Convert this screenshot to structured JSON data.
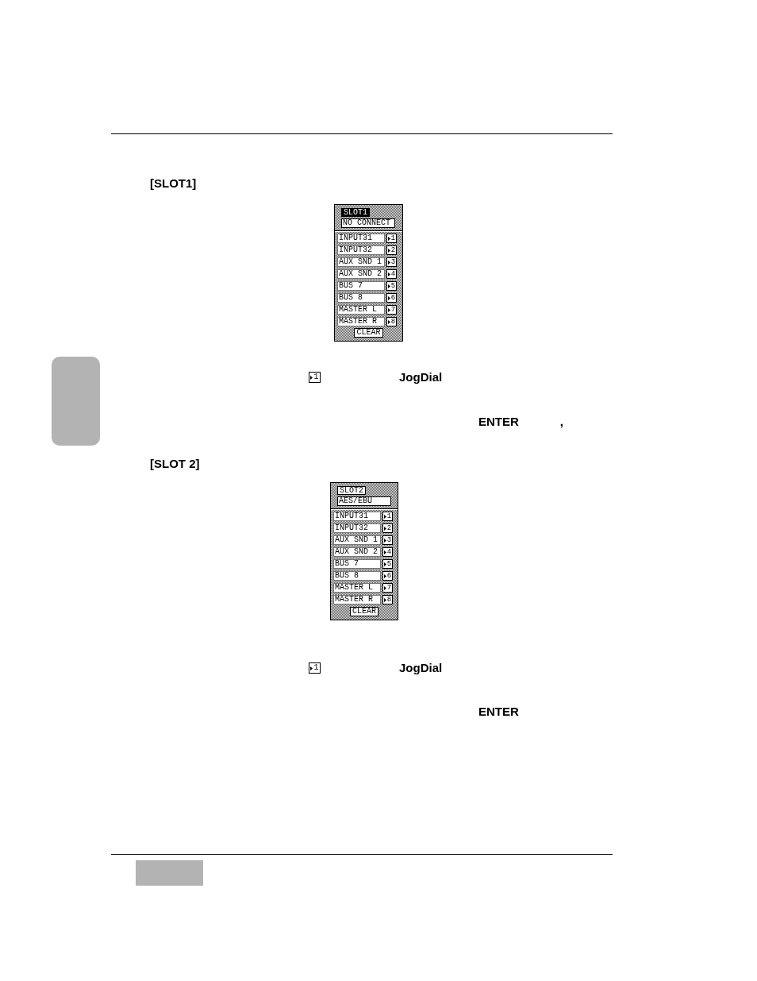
{
  "sections": [
    {
      "heading": "[SLOT1]",
      "panel": {
        "title": {
          "text": "SLOT1",
          "selected": true
        },
        "source": "NO CONNECT",
        "rows": [
          {
            "label": "INPUT31",
            "key": "1"
          },
          {
            "label": "INPUT32",
            "key": "2"
          },
          {
            "label": "AUX SND 1",
            "key": "3"
          },
          {
            "label": "AUX SND 2",
            "key": "4"
          },
          {
            "label": "BUS 7",
            "key": "5"
          },
          {
            "label": "BUS 8",
            "key": "6"
          },
          {
            "label": "MASTER L",
            "key": "7"
          },
          {
            "label": "MASTER R",
            "key": "8"
          }
        ],
        "clear_button": "CLEAR"
      },
      "steps": [
        {
          "kind": "dial",
          "key": "1",
          "control": "JogDial"
        },
        {
          "kind": "confirm",
          "control": "ENTER",
          "punctuation": ","
        }
      ]
    },
    {
      "heading": "[SLOT 2]",
      "panel": {
        "title": {
          "text": "SLOT2",
          "selected": false
        },
        "source": "AES/EBU",
        "rows": [
          {
            "label": "INPUT31",
            "key": "1"
          },
          {
            "label": "INPUT32",
            "key": "2"
          },
          {
            "label": "AUX SND 1",
            "key": "3"
          },
          {
            "label": "AUX SND 2",
            "key": "4"
          },
          {
            "label": "BUS 7",
            "key": "5"
          },
          {
            "label": "BUS 8",
            "key": "6"
          },
          {
            "label": "MASTER L",
            "key": "7"
          },
          {
            "label": "MASTER R",
            "key": "8"
          }
        ],
        "clear_button": "CLEAR"
      },
      "steps": [
        {
          "kind": "dial",
          "key": "1",
          "control": "JogDial"
        },
        {
          "kind": "confirm",
          "control": "ENTER"
        }
      ]
    }
  ]
}
